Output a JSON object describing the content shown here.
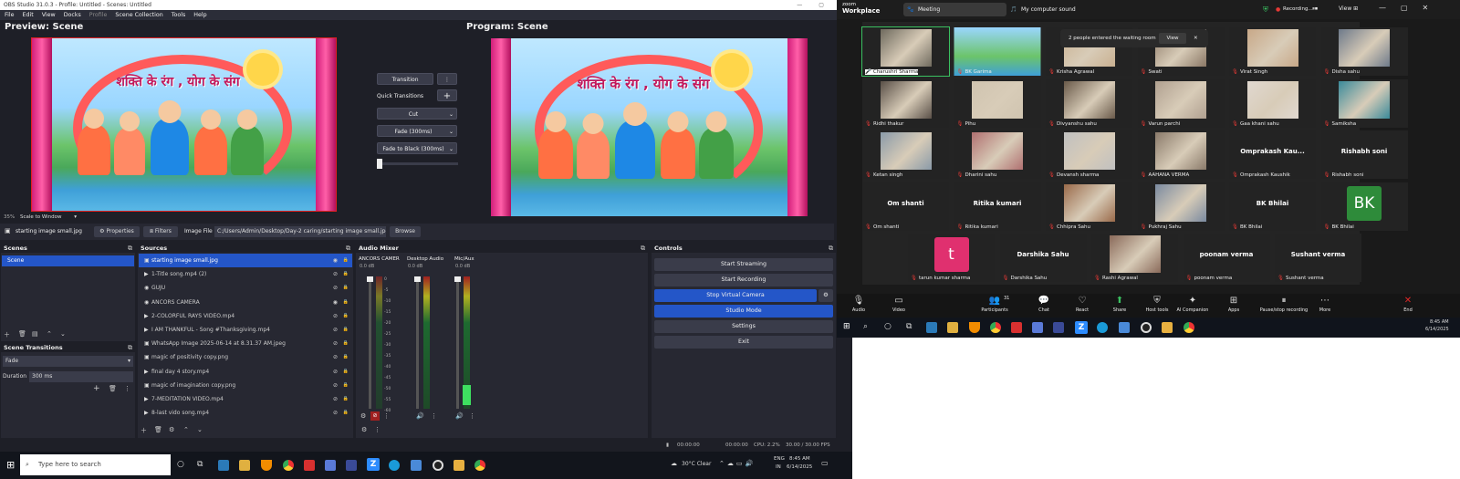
{
  "obs": {
    "title": "OBS Studio 31.0.3 - Profile: Untitled - Scenes: Untitled",
    "menu": [
      "File",
      "Edit",
      "View",
      "Docks",
      "Profile",
      "Scene Collection",
      "Tools",
      "Help"
    ],
    "preview_title": "Preview: Scene",
    "program_title": "Program: Scene",
    "scene_image_text": "शक्ति के रंग , योग के संग",
    "zoom_level": "35%",
    "scale_mode": "Scale to Window",
    "transition": {
      "button": "Transition",
      "quick_label": "Quick Transitions",
      "options": [
        "Cut",
        "Fade (300ms)",
        "Fade to Black (300ms)"
      ]
    },
    "source_toolbar": {
      "selected": "starting image small.jpg",
      "properties": "Properties",
      "filters": "Filters",
      "image_file_label": "Image File",
      "path": "C:/Users/Admin/Desktop/Day-2 caring/starting image small.jpg",
      "browse": "Browse"
    },
    "scenes": {
      "title": "Scenes",
      "items": [
        "Scene"
      ]
    },
    "scene_transitions": {
      "title": "Scene Transitions",
      "type": "Fade",
      "duration_label": "Duration",
      "duration": "300 ms"
    },
    "sources": {
      "title": "Sources",
      "items": [
        {
          "name": "starting image small.jpg",
          "icon": "image"
        },
        {
          "name": "1-Title song.mp4 (2)",
          "icon": "play"
        },
        {
          "name": "GUJU",
          "icon": "camera"
        },
        {
          "name": "ANCORS CAMERA",
          "icon": "camera"
        },
        {
          "name": "2-COLORFUL RAYS VIDEO.mp4",
          "icon": "play"
        },
        {
          "name": "I AM THANKFUL - Song #Thanksgiving.mp4",
          "icon": "play"
        },
        {
          "name": "WhatsApp Image 2025-06-14 at 8.31.37 AM.jpeg",
          "icon": "image"
        },
        {
          "name": "magic of positivity copy.png",
          "icon": "image"
        },
        {
          "name": "final day 4 story.mp4",
          "icon": "play"
        },
        {
          "name": "magic of imagination copy.png",
          "icon": "image"
        },
        {
          "name": "7-MEDITATION VIDEO.mp4",
          "icon": "play"
        },
        {
          "name": "8-last vido song.mp4",
          "icon": "play"
        }
      ]
    },
    "mixer": {
      "title": "Audio Mixer",
      "channels": [
        {
          "name": "ANCORS CAMER",
          "db": "0.0 dB"
        },
        {
          "name": "Desktop Audio",
          "db": "0.0 dB"
        },
        {
          "name": "Mic/Aux",
          "db": "0.0 dB"
        }
      ],
      "scale": [
        "0",
        "-5",
        "-10",
        "-15",
        "-20",
        "-25",
        "-30",
        "-35",
        "-40",
        "-45",
        "-50",
        "-55",
        "-60"
      ]
    },
    "controls": {
      "title": "Controls",
      "buttons": [
        "Start Streaming",
        "Start Recording",
        "Stop Virtual Camera",
        "Studio Mode",
        "Settings",
        "Exit"
      ]
    },
    "status": {
      "time1": "00:00:00",
      "time2": "00:00:00",
      "cpu": "CPU: 2.2%",
      "fps": "30.00 / 30.00 FPS"
    }
  },
  "taskbar": {
    "search_placeholder": "Type here to search",
    "weather": "30°C  Clear",
    "lang": "ENG",
    "region": "IN",
    "time": "8:45 AM",
    "date": "6/14/2025"
  },
  "zoom": {
    "brand_top": "zoom",
    "brand": "Workplace",
    "tab_meeting": "Meeting",
    "tab_sound": "My computer sound",
    "recording": "Recording...",
    "view": "View",
    "waiting_msg": "2 people entered the waiting room",
    "waiting_view": "View",
    "participants": [
      {
        "name": "Charushri Sharma",
        "big": ""
      },
      {
        "name": "BK Garima",
        "big": ""
      },
      {
        "name": "Krisha Agrawal",
        "big": ""
      },
      {
        "name": "Swati",
        "big": ""
      },
      {
        "name": "Virat Singh",
        "big": ""
      },
      {
        "name": "Disha sahu",
        "big": ""
      },
      {
        "name": "Ridhi thakur",
        "big": ""
      },
      {
        "name": "Pihu",
        "big": ""
      },
      {
        "name": "Divyanshu sahu",
        "big": ""
      },
      {
        "name": "Varun parchi",
        "big": ""
      },
      {
        "name": "Gaa khani sahu",
        "big": ""
      },
      {
        "name": "Samiksha",
        "big": ""
      },
      {
        "name": "Ketan singh",
        "big": ""
      },
      {
        "name": "Dharini sahu",
        "big": ""
      },
      {
        "name": "Devansh sharma",
        "big": ""
      },
      {
        "name": "AAHANA VERMA",
        "big": ""
      },
      {
        "name": "Omprakash Kaushik",
        "big": "Omprakash  Kau..."
      },
      {
        "name": "Rishabh soni",
        "big": "Rishabh soni"
      },
      {
        "name": "Om shanti",
        "big": "Om shanti"
      },
      {
        "name": "Ritika kumari",
        "big": "Ritika kumari"
      },
      {
        "name": "Chhipra Sahu",
        "big": ""
      },
      {
        "name": "Pukhraj Sahu",
        "big": ""
      },
      {
        "name": "BK Bhilai",
        "big": "BK Bhilai"
      },
      {
        "name": "BK Bhilai",
        "big": "BK"
      },
      {
        "name": "tarun kumar sharma",
        "big": "t"
      },
      {
        "name": "Darshika Sahu",
        "big": "Darshika Sahu"
      },
      {
        "name": "Rashi Agrawal",
        "big": ""
      },
      {
        "name": "poonam verma",
        "big": "poonam verma"
      },
      {
        "name": "Sushant verma",
        "big": "Sushant verma"
      }
    ],
    "toolbar": [
      {
        "label": "Audio",
        "glyph": "🎙"
      },
      {
        "label": "Video",
        "glyph": "▭"
      },
      {
        "label": "Participants",
        "glyph": "👥"
      },
      {
        "label": "Chat",
        "glyph": "💬"
      },
      {
        "label": "React",
        "glyph": "♡"
      },
      {
        "label": "Share",
        "glyph": "⬆"
      },
      {
        "label": "Host tools",
        "glyph": "⛨"
      },
      {
        "label": "AI Companion",
        "glyph": "✦"
      },
      {
        "label": "Apps",
        "glyph": "⊞"
      },
      {
        "label": "Pause/stop recording",
        "glyph": "⏸"
      },
      {
        "label": "More",
        "glyph": "⋯"
      },
      {
        "label": "End",
        "glyph": "✕"
      }
    ],
    "participants_count": "31",
    "time": "8:45 AM",
    "date": "6/14/2025"
  },
  "colors": {
    "obs_bg": "#1e1f27",
    "obs_accent": "#2456c8",
    "zoom_bg": "#1a1a1a",
    "rec_red": "#e53935",
    "end_red": "#e02828",
    "avatar_green": "#2e8b3a",
    "avatar_pink": "#e0306f"
  }
}
